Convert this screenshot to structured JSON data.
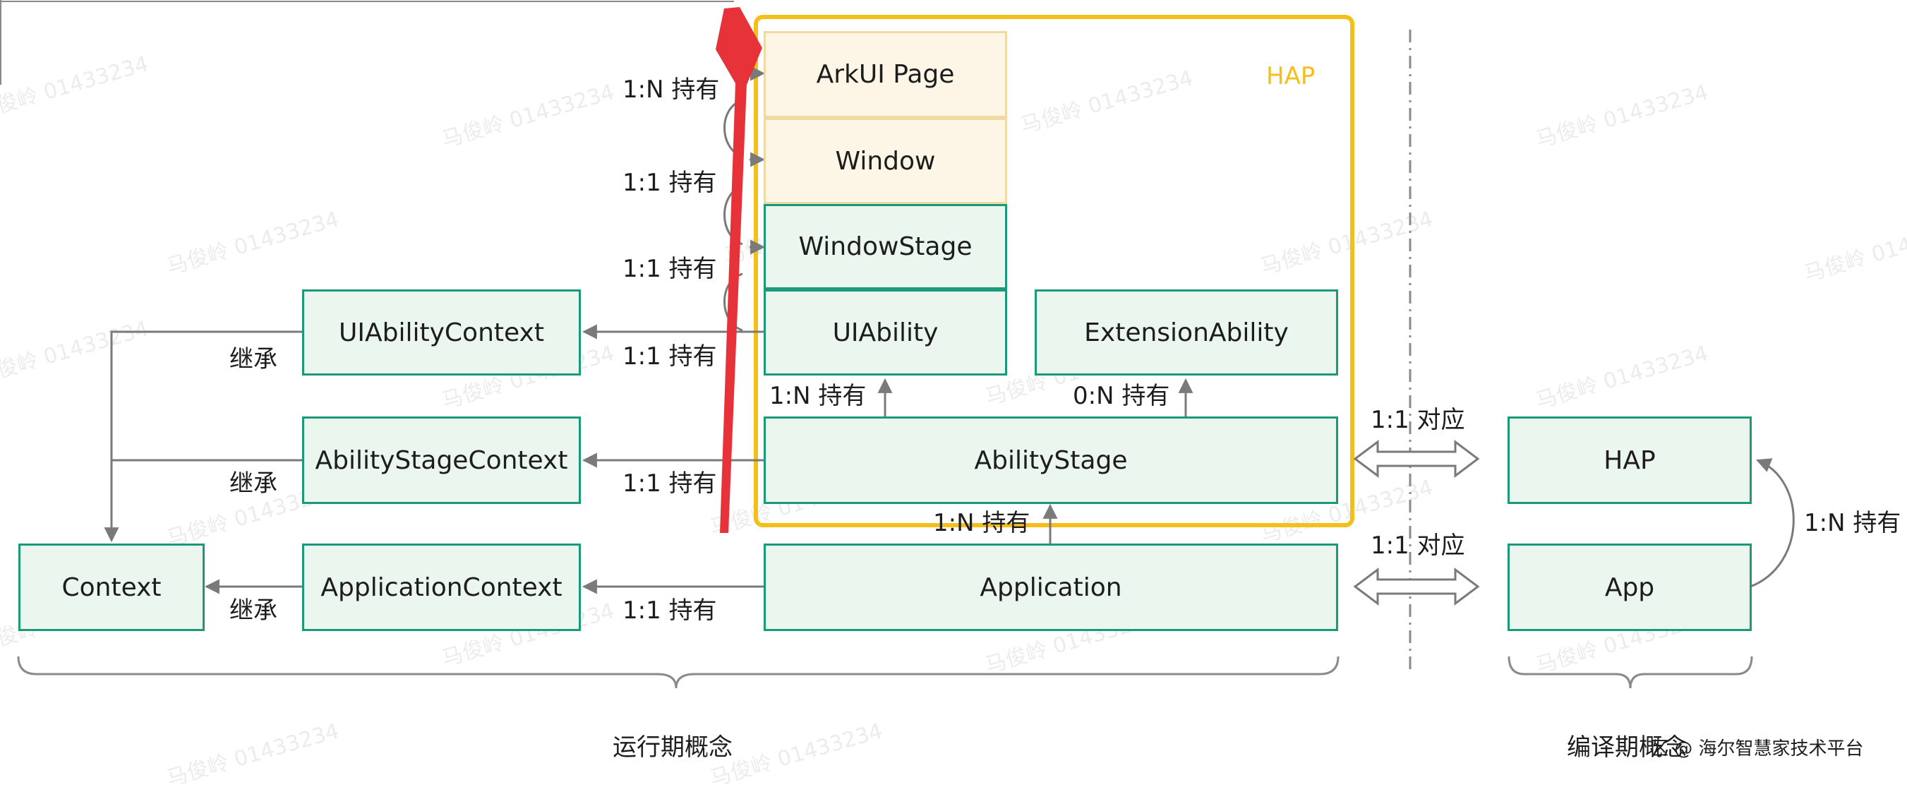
{
  "boxes": {
    "arkui_page": "ArkUI Page",
    "window": "Window",
    "window_stage": "WindowStage",
    "ui_ability": "UIAbility",
    "extension_ability": "ExtensionAbility",
    "ability_stage": "AbilityStage",
    "application": "Application",
    "ui_ability_context": "UIAbilityContext",
    "ability_stage_context": "AbilityStageContext",
    "application_context": "ApplicationContext",
    "context": "Context",
    "hap": "HAP",
    "app": "App"
  },
  "hap_group_label": "HAP",
  "relations": {
    "arkui_window": "1:N 持有",
    "window_windowstage": "1:1 持有",
    "windowstage_uiability": "1:1 持有",
    "uiability_context": "1:1 持有",
    "abilitystage_uiability": "1:N 持有",
    "abilitystage_extension": "0:N 持有",
    "abilitystage_context": "1:1 持有",
    "application_abilitystage": "1:N 持有",
    "application_context": "1:1 持有",
    "inherit_uiability": "继承",
    "inherit_abilitystage": "继承",
    "inherit_application": "继承",
    "corr_hap": "1:1 对应",
    "corr_app": "1:1 对应",
    "app_hap": "1:N 持有"
  },
  "sections": {
    "runtime": "运行期概念",
    "compile": "编译期概念"
  },
  "watermark": "马俊岭 01433234",
  "footer_credit": "区 @ 海尔智慧家技术平台",
  "colors": {
    "box_fill": "#eaf6ee",
    "box_border": "#1b9a7a",
    "warm_fill": "#fdf6e6",
    "hap_frame": "#f5bf1a",
    "red_arrow": "#e8323a"
  }
}
